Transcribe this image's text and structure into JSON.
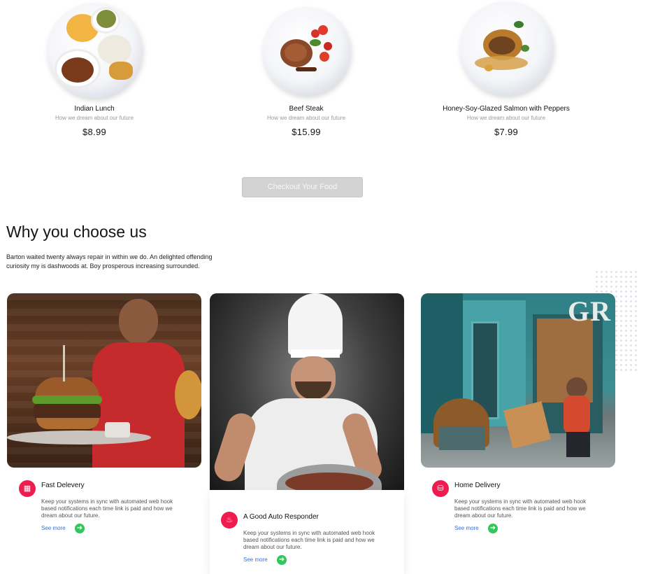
{
  "dishes": [
    {
      "name": "Indian Lunch",
      "subtitle": "How we dream about our future",
      "price": "$8.99"
    },
    {
      "name": "Beef Steak",
      "subtitle": "How we dream about our future",
      "price": "$15.99"
    },
    {
      "name": "Honey-Soy-Glazed Salmon with Peppers",
      "subtitle": "How we dream about our future",
      "price": "$7.99"
    }
  ],
  "checkout": {
    "label": "Checkout Your Food"
  },
  "why": {
    "title": "Why you choose us",
    "text": "Barton waited twenty always repair in within we do. An delighted offending curiosity my is dashwoods at. Boy prosperous increasing surrounded."
  },
  "storefront_sign": "GR",
  "features": [
    {
      "title": "Fast Delevery",
      "text": "Keep your systems in sync with automated web hook based notifications each  time link is paid and how we dream about our future.",
      "link": "See more",
      "icon": "bus-icon"
    },
    {
      "title": "A Good Auto Responder",
      "text": "Keep your systems in sync with automated web hook based notifications each  time link is paid and how we dream about our future.",
      "link": "See more",
      "icon": "bell-icon"
    },
    {
      "title": "Home Delivery",
      "text": "Keep your systems in sync with automated web hook based notifications each  time link is paid and how we dream about our future.",
      "link": "See more",
      "icon": "truck-icon"
    }
  ],
  "colors": {
    "accent": "#ee1c4f",
    "arrow": "#31c75b",
    "link": "#3b6fd6"
  }
}
